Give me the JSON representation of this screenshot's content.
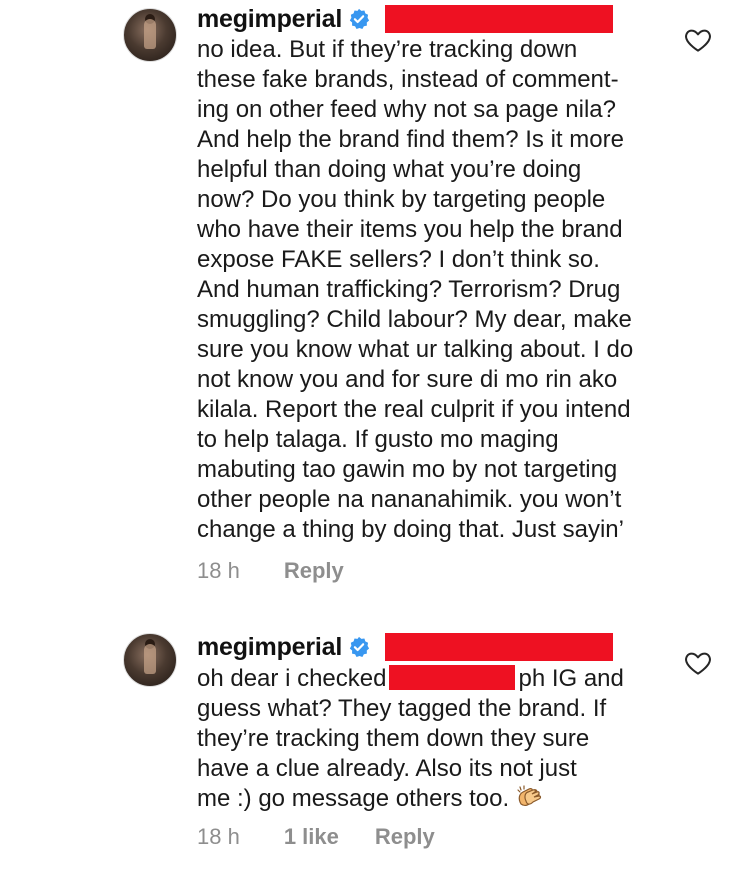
{
  "comments": [
    {
      "username": "megimperial",
      "verified_icon": "verified-badge-icon",
      "lines": [
        "no idea. But if they’re tracking down",
        "these fake brands, instead of comment-",
        "ing on other feed why not sa page nila?",
        "And help the brand find them? Is it more",
        "helpful than doing what you’re doing",
        "now? Do you think by targeting people",
        "who have their items you help the brand",
        "expose FAKE sellers? I don’t think so.",
        "And human trafficking? Terrorism? Drug",
        "smuggling? Child labour? My dear, make",
        "sure you know what ur talking about. I do",
        "not know you and for sure di mo rin ako",
        "kilala. Report the real culprit if you intend",
        "to help talaga. If gusto mo maging",
        "mabuting tao gawin mo by not targeting",
        "other people na nananahimik. you won’t",
        "change a thing by doing that. Just sayin’"
      ],
      "time": "18 h",
      "reply_label": "Reply",
      "like_icon": "heart-outline-icon"
    },
    {
      "username": "megimperial",
      "verified_icon": "verified-badge-icon",
      "line1_before": "oh dear i checked",
      "line1_after_redaction": "ph IG and",
      "lines": [
        "guess what? They tagged the brand. If",
        "they’re tracking them down they sure",
        "have a clue already. Also its not just"
      ],
      "last_line": "me :) go message others too.",
      "emoji_icon": "clapping-hands-emoji-icon",
      "time": "18 h",
      "likes_label": "1 like",
      "reply_label": "Reply",
      "like_icon": "heart-outline-icon"
    }
  ],
  "colors": {
    "redaction": "#ee1122",
    "verified_blue": "#3897f0",
    "meta_gray": "#8e8e8e",
    "text": "#1a1a1a"
  }
}
